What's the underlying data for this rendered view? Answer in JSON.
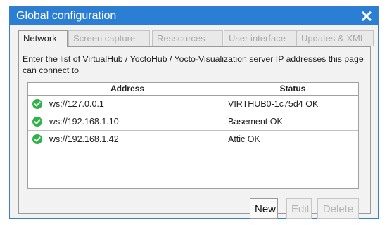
{
  "dialog": {
    "title": "Global configuration",
    "close_icon": "close-icon"
  },
  "tabs": [
    {
      "label": "Network",
      "active": true
    },
    {
      "label": "Screen capture",
      "active": false
    },
    {
      "label": "Ressources",
      "active": false
    },
    {
      "label": "User interface",
      "active": false
    },
    {
      "label": "Updates & XML",
      "active": false
    }
  ],
  "network": {
    "description": "Enter the list of VirtualHub / YoctoHub / Yocto-Visualization server IP addresses this page can connect to",
    "columns": {
      "address": "Address",
      "status": "Status"
    },
    "rows": [
      {
        "address": "ws://127.0.0.1",
        "status": "VIRTHUB0-1c75d4 OK",
        "icon": "check-ok-icon"
      },
      {
        "address": "ws://192.168.1.10",
        "status": "Basement OK",
        "icon": "check-ok-icon"
      },
      {
        "address": "ws://192.168.1.42",
        "status": "Attic OK",
        "icon": "check-ok-icon"
      }
    ]
  },
  "buttons": {
    "new_label": "New",
    "edit_label": "Edit",
    "delete_label": "Delete"
  },
  "colors": {
    "titlebar": "#2a7fd4",
    "ok_icon": "#2db34a"
  }
}
